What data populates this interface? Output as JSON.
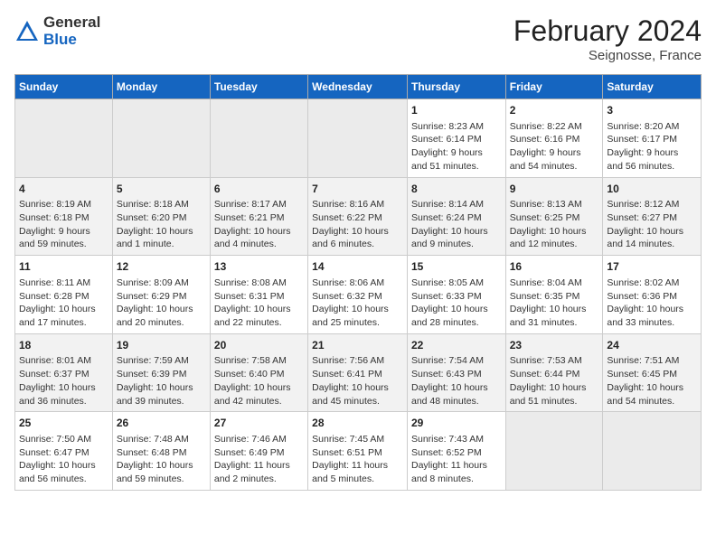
{
  "header": {
    "logo_general": "General",
    "logo_blue": "Blue",
    "month_year": "February 2024",
    "location": "Seignosse, France"
  },
  "columns": [
    "Sunday",
    "Monday",
    "Tuesday",
    "Wednesday",
    "Thursday",
    "Friday",
    "Saturday"
  ],
  "weeks": [
    [
      {
        "day": "",
        "info": ""
      },
      {
        "day": "",
        "info": ""
      },
      {
        "day": "",
        "info": ""
      },
      {
        "day": "",
        "info": ""
      },
      {
        "day": "1",
        "info": "Sunrise: 8:23 AM\nSunset: 6:14 PM\nDaylight: 9 hours\nand 51 minutes."
      },
      {
        "day": "2",
        "info": "Sunrise: 8:22 AM\nSunset: 6:16 PM\nDaylight: 9 hours\nand 54 minutes."
      },
      {
        "day": "3",
        "info": "Sunrise: 8:20 AM\nSunset: 6:17 PM\nDaylight: 9 hours\nand 56 minutes."
      }
    ],
    [
      {
        "day": "4",
        "info": "Sunrise: 8:19 AM\nSunset: 6:18 PM\nDaylight: 9 hours\nand 59 minutes."
      },
      {
        "day": "5",
        "info": "Sunrise: 8:18 AM\nSunset: 6:20 PM\nDaylight: 10 hours\nand 1 minute."
      },
      {
        "day": "6",
        "info": "Sunrise: 8:17 AM\nSunset: 6:21 PM\nDaylight: 10 hours\nand 4 minutes."
      },
      {
        "day": "7",
        "info": "Sunrise: 8:16 AM\nSunset: 6:22 PM\nDaylight: 10 hours\nand 6 minutes."
      },
      {
        "day": "8",
        "info": "Sunrise: 8:14 AM\nSunset: 6:24 PM\nDaylight: 10 hours\nand 9 minutes."
      },
      {
        "day": "9",
        "info": "Sunrise: 8:13 AM\nSunset: 6:25 PM\nDaylight: 10 hours\nand 12 minutes."
      },
      {
        "day": "10",
        "info": "Sunrise: 8:12 AM\nSunset: 6:27 PM\nDaylight: 10 hours\nand 14 minutes."
      }
    ],
    [
      {
        "day": "11",
        "info": "Sunrise: 8:11 AM\nSunset: 6:28 PM\nDaylight: 10 hours\nand 17 minutes."
      },
      {
        "day": "12",
        "info": "Sunrise: 8:09 AM\nSunset: 6:29 PM\nDaylight: 10 hours\nand 20 minutes."
      },
      {
        "day": "13",
        "info": "Sunrise: 8:08 AM\nSunset: 6:31 PM\nDaylight: 10 hours\nand 22 minutes."
      },
      {
        "day": "14",
        "info": "Sunrise: 8:06 AM\nSunset: 6:32 PM\nDaylight: 10 hours\nand 25 minutes."
      },
      {
        "day": "15",
        "info": "Sunrise: 8:05 AM\nSunset: 6:33 PM\nDaylight: 10 hours\nand 28 minutes."
      },
      {
        "day": "16",
        "info": "Sunrise: 8:04 AM\nSunset: 6:35 PM\nDaylight: 10 hours\nand 31 minutes."
      },
      {
        "day": "17",
        "info": "Sunrise: 8:02 AM\nSunset: 6:36 PM\nDaylight: 10 hours\nand 33 minutes."
      }
    ],
    [
      {
        "day": "18",
        "info": "Sunrise: 8:01 AM\nSunset: 6:37 PM\nDaylight: 10 hours\nand 36 minutes."
      },
      {
        "day": "19",
        "info": "Sunrise: 7:59 AM\nSunset: 6:39 PM\nDaylight: 10 hours\nand 39 minutes."
      },
      {
        "day": "20",
        "info": "Sunrise: 7:58 AM\nSunset: 6:40 PM\nDaylight: 10 hours\nand 42 minutes."
      },
      {
        "day": "21",
        "info": "Sunrise: 7:56 AM\nSunset: 6:41 PM\nDaylight: 10 hours\nand 45 minutes."
      },
      {
        "day": "22",
        "info": "Sunrise: 7:54 AM\nSunset: 6:43 PM\nDaylight: 10 hours\nand 48 minutes."
      },
      {
        "day": "23",
        "info": "Sunrise: 7:53 AM\nSunset: 6:44 PM\nDaylight: 10 hours\nand 51 minutes."
      },
      {
        "day": "24",
        "info": "Sunrise: 7:51 AM\nSunset: 6:45 PM\nDaylight: 10 hours\nand 54 minutes."
      }
    ],
    [
      {
        "day": "25",
        "info": "Sunrise: 7:50 AM\nSunset: 6:47 PM\nDaylight: 10 hours\nand 56 minutes."
      },
      {
        "day": "26",
        "info": "Sunrise: 7:48 AM\nSunset: 6:48 PM\nDaylight: 10 hours\nand 59 minutes."
      },
      {
        "day": "27",
        "info": "Sunrise: 7:46 AM\nSunset: 6:49 PM\nDaylight: 11 hours\nand 2 minutes."
      },
      {
        "day": "28",
        "info": "Sunrise: 7:45 AM\nSunset: 6:51 PM\nDaylight: 11 hours\nand 5 minutes."
      },
      {
        "day": "29",
        "info": "Sunrise: 7:43 AM\nSunset: 6:52 PM\nDaylight: 11 hours\nand 8 minutes."
      },
      {
        "day": "",
        "info": ""
      },
      {
        "day": "",
        "info": ""
      }
    ]
  ]
}
